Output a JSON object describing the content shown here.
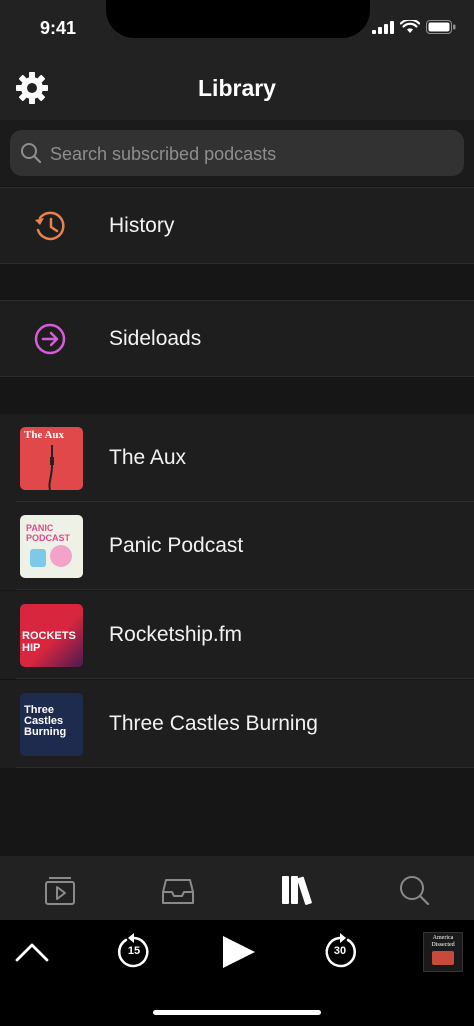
{
  "status": {
    "time": "9:41"
  },
  "nav": {
    "title": "Library"
  },
  "search": {
    "placeholder": "Search subscribed podcasts"
  },
  "sections": {
    "history": {
      "label": "History",
      "icon": "history-icon",
      "color": "#e8834a"
    },
    "sideloads": {
      "label": "Sideloads",
      "icon": "sideload-arrow-icon",
      "color": "#d65cd9"
    }
  },
  "podcasts": [
    {
      "title": "The Aux",
      "art_text": "The Aux",
      "art_color": "#e0484a"
    },
    {
      "title": "Panic Podcast",
      "art_text": "PANIC PODCAST",
      "art_color": "#e8f0e0"
    },
    {
      "title": "Rocketship.fm",
      "art_text": "ROCKETSHIP",
      "art_color": "#d8263e"
    },
    {
      "title": "Three Castles Burning",
      "art_text": "Three Castles Burning",
      "art_color": "#1f2b4e"
    }
  ],
  "tabs": [
    "now-playing-icon",
    "inbox-icon",
    "library-icon",
    "search-icon"
  ],
  "player": {
    "skip_back": "15",
    "skip_forward": "30",
    "now_playing_art_text": "America Dissected"
  }
}
